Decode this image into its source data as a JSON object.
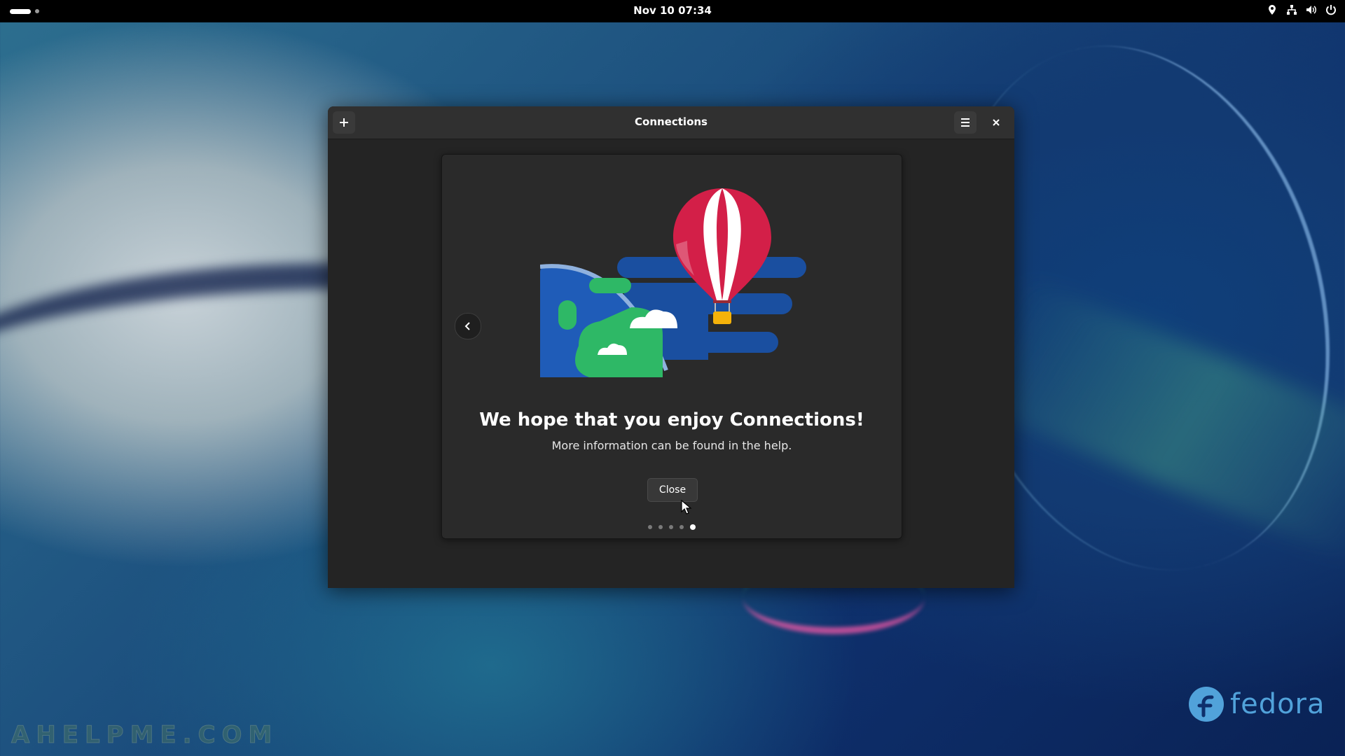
{
  "topbar": {
    "datetime": "Nov 10  07:34",
    "activities_icon": "activities-icon",
    "tray_icons": [
      "location-icon",
      "network-icon",
      "volume-icon",
      "power-icon"
    ]
  },
  "window": {
    "title": "Connections",
    "add_icon": "plus-icon",
    "menu_icon": "hamburger-menu-icon",
    "close_icon": "close-icon"
  },
  "welcome": {
    "headline": "We hope that you enjoy Connections!",
    "subtext": "More information can be found in the help.",
    "close_label": "Close",
    "back_icon": "chevron-left-icon",
    "page_count": 5,
    "current_page": 5
  },
  "desktop": {
    "logo_text": "fedora",
    "watermark": "AHELPME.COM"
  },
  "colors": {
    "balloon_red": "#d31f48",
    "sky_blue": "#1a4fa0",
    "earth_green": "#2eb866",
    "basket_yellow": "#f5b20a",
    "fedora_blue": "#51a2da"
  }
}
